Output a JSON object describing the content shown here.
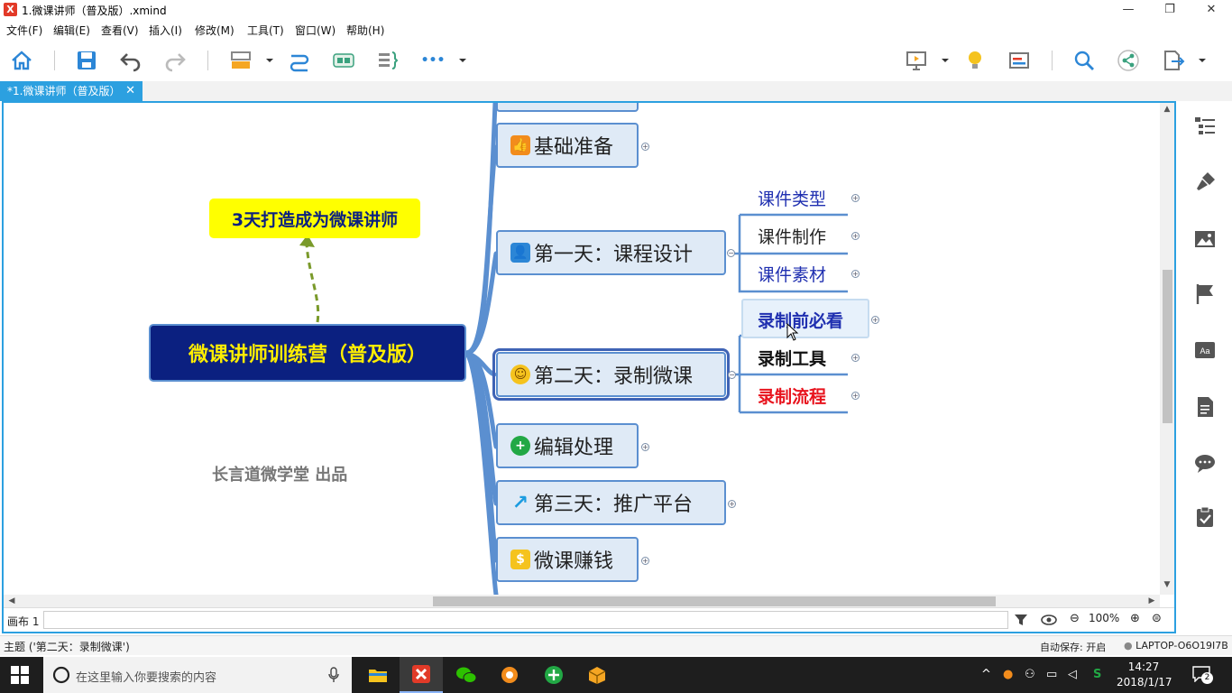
{
  "window": {
    "title": "1.微课讲师（普及版）.xmind",
    "logo": "X",
    "minimize": "—",
    "maximize": "❐",
    "close": "✕"
  },
  "menu": {
    "items": [
      "文件(F)",
      "编辑(E)",
      "查看(V)",
      "插入(I)",
      "修改(M)",
      "工具(T)",
      "窗口(W)",
      "帮助(H)"
    ]
  },
  "toolbar": {
    "more": "•••"
  },
  "tab": {
    "label": "*1.微课讲师（普及版）",
    "close": "✕"
  },
  "mindmap": {
    "central": "微课讲师训练营（普及版）",
    "callout": "3天打造成为微课讲师",
    "credit": "长言道微学堂 出品",
    "branches": [
      {
        "label": "基础准备",
        "icon": "thumbs-up-icon",
        "color": "#f28c1c",
        "glyph": "👍"
      },
      {
        "label": "第一天：课程设计",
        "icon": "user-card-icon",
        "color": "#2c86d6",
        "glyph": "👤"
      },
      {
        "label": "第二天：录制微课",
        "icon": "smiley-icon",
        "color": "#f5c31e",
        "glyph": "☺"
      },
      {
        "label": "编辑处理",
        "icon": "plus-circle-icon",
        "color": "#22a845",
        "glyph": "+"
      },
      {
        "label": "第三天：推广平台",
        "icon": "arrow-up-right-icon",
        "color": "#1c9ce0",
        "glyph": "↗"
      },
      {
        "label": "微课赚钱",
        "icon": "dollar-icon",
        "color": "#f5c31e",
        "glyph": "$"
      }
    ],
    "day1_children": [
      {
        "label": "课件类型",
        "color": "#1f2fb0"
      },
      {
        "label": "课件制作",
        "color": "#222222"
      },
      {
        "label": "课件素材",
        "color": "#1f2fb0"
      }
    ],
    "day2_children": [
      {
        "label": "录制前必看",
        "color": "#1f2fb0"
      },
      {
        "label": "录制工具",
        "color": "#111111"
      },
      {
        "label": "录制流程",
        "color": "#e8141e"
      }
    ]
  },
  "sheet": {
    "label": "画布 1",
    "zoom": "100%"
  },
  "status": {
    "topic": "主题 ('第二天：录制微课')",
    "autosave": "自动保存: 开启",
    "device": "LAPTOP-O6O19I7B"
  },
  "taskbar": {
    "search_placeholder": "在这里输入你要搜索的内容",
    "time": "14:27",
    "date": "2018/1/17",
    "notifications": "2"
  },
  "colors": {
    "accent": "#2ca0e0",
    "branch_line": "#5b8fd0",
    "central_bg": "#0b2080",
    "central_text": "#ffee00"
  }
}
